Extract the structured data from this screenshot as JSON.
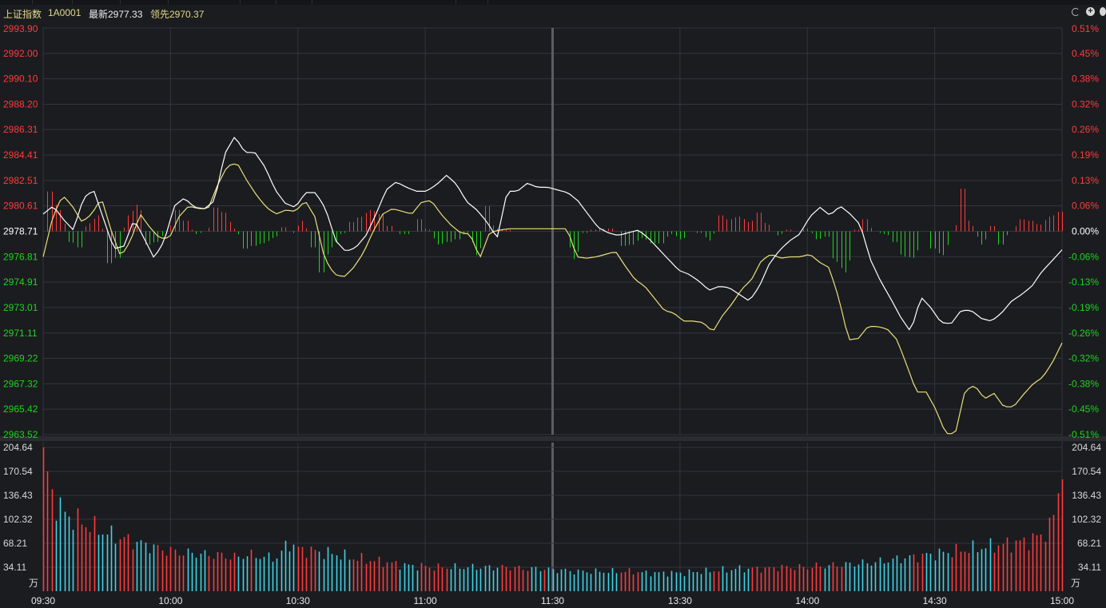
{
  "header": {
    "index_name": "上证指数",
    "code": "1A0001",
    "latest_label": "最新2977.33",
    "lead_label": "领先2970.37"
  },
  "colors": {
    "background": "#1b1c20",
    "grid": "#33353b",
    "up_red": "#ff3b3b",
    "down_green": "#1ed41e",
    "price_line": "#ffffff",
    "lead_line": "#e8e07a",
    "volume_cyan": "#3fd3e6",
    "header_yellow": "#e0d98a"
  },
  "chart_data": [
    {
      "type": "line",
      "name": "intraday price",
      "prev_close": 2978.71,
      "left_axis_ticks": [
        "2993.90",
        "2992.00",
        "2990.10",
        "2988.20",
        "2986.31",
        "2984.41",
        "2982.51",
        "2980.61",
        "2978.71",
        "2976.81",
        "2974.91",
        "2973.01",
        "2971.11",
        "2969.22",
        "2967.32",
        "2965.42",
        "2963.52"
      ],
      "right_axis_ticks": [
        "0.51%",
        "0.45%",
        "0.38%",
        "0.32%",
        "0.26%",
        "0.19%",
        "0.13%",
        "0.06%",
        "0.00%",
        "-0.06%",
        "-0.13%",
        "-0.19%",
        "-0.26%",
        "-0.32%",
        "-0.38%",
        "-0.45%",
        "-0.51%"
      ],
      "ylim": [
        2963.52,
        2993.9
      ],
      "x_ticks": [
        "09:30",
        "10:00",
        "10:30",
        "11:00",
        "11:30",
        "13:30",
        "14:00",
        "14:30",
        "15:00"
      ],
      "price_series": [
        2980.0,
        2980.6,
        2979.6,
        2978.8,
        2981.2,
        2981.8,
        2979.6,
        2977.4,
        2977.6,
        2979.6,
        2978.2,
        2976.7,
        2978.0,
        2980.6,
        2981.2,
        2980.5,
        2980.4,
        2981.0,
        2984.5,
        2985.8,
        2984.6,
        2984.6,
        2983.5,
        2981.8,
        2980.8,
        2980.5,
        2981.6,
        2981.6,
        2980.4,
        2978.0,
        2977.2,
        2977.5,
        2978.4,
        2980.0,
        2981.8,
        2982.4,
        2982.0,
        2981.7,
        2981.7,
        2982.2,
        2982.9,
        2982.2,
        2980.9,
        2980.3,
        2979.4,
        2978.2,
        2981.7,
        2981.7,
        2982.3,
        2982.0,
        2982.0,
        2981.8,
        2981.6,
        2981.0,
        2980.0,
        2979.0,
        2978.6,
        2978.4,
        2978.6,
        2978.8,
        2978.2,
        2977.4,
        2976.6,
        2975.8,
        2975.5,
        2975.0,
        2974.3,
        2974.6,
        2974.5,
        2974.0,
        2973.5,
        2974.6,
        2976.3,
        2977.3,
        2978.0,
        2978.5,
        2979.8,
        2980.5,
        2979.9,
        2980.6,
        2980.0,
        2979.2,
        2976.6,
        2975.0,
        2973.7,
        2972.3,
        2971.2,
        2973.8,
        2973.0,
        2971.9,
        2971.8,
        2972.8,
        2972.8,
        2972.2,
        2972.0,
        2972.6,
        2973.5,
        2974.0,
        2974.6,
        2975.7,
        2976.5,
        2977.33
      ],
      "lead_series": [
        2976.8,
        2979.8,
        2981.4,
        2980.6,
        2979.4,
        2980.0,
        2981.2,
        2978.8,
        2976.8,
        2978.0,
        2980.0,
        2979.0,
        2978.2,
        2978.2,
        2979.8,
        2980.6,
        2980.4,
        2980.4,
        2982.2,
        2983.6,
        2983.8,
        2982.5,
        2981.4,
        2980.5,
        2980.0,
        2980.3,
        2980.2,
        2981.0,
        2979.8,
        2976.7,
        2975.5,
        2975.3,
        2976.0,
        2977.1,
        2978.7,
        2980.0,
        2980.4,
        2980.2,
        2980.0,
        2980.9,
        2981.0,
        2980.0,
        2979.2,
        2978.6,
        2978.5,
        2976.7,
        2978.6,
        2978.8,
        2978.9,
        2978.9,
        2978.9,
        2978.9,
        2978.9,
        2978.9,
        2978.9,
        2976.8,
        2976.7,
        2976.8,
        2977.0,
        2977.2,
        2976.1,
        2975.1,
        2974.6,
        2973.7,
        2972.8,
        2972.6,
        2972.0,
        2972.0,
        2971.9,
        2971.2,
        2972.4,
        2973.3,
        2974.4,
        2975.1,
        2976.5,
        2977.0,
        2976.7,
        2976.8,
        2976.8,
        2977.0,
        2976.4,
        2976.0,
        2973.7,
        2970.6,
        2970.7,
        2971.6,
        2971.6,
        2971.4,
        2970.6,
        2968.7,
        2966.7,
        2966.7,
        2965.4,
        2963.6,
        2963.6,
        2966.8,
        2967.2,
        2966.2,
        2966.6,
        2965.6,
        2965.6,
        2966.5,
        2967.3,
        2967.8,
        2968.9,
        2970.37
      ]
    },
    {
      "type": "bar",
      "name": "volume",
      "unit": "万",
      "ylim": [
        0,
        204.64
      ],
      "axis_ticks": [
        "204.64",
        "170.54",
        "136.43",
        "102.32",
        "68.21",
        "34.11"
      ],
      "values": [
        190,
        128,
        112,
        102,
        96,
        90,
        84,
        78,
        74,
        70,
        66,
        62,
        58,
        56,
        54,
        54,
        52,
        52,
        50,
        48,
        52,
        50,
        48,
        48,
        70,
        60,
        58,
        56,
        54,
        52,
        48,
        46,
        44,
        42,
        40,
        38,
        36,
        36,
        34,
        34,
        34,
        34,
        34,
        34,
        34,
        34,
        34,
        32,
        32,
        32,
        30,
        30,
        28,
        28,
        28,
        28,
        28,
        28,
        28,
        26,
        26,
        26,
        26,
        26,
        28,
        28,
        30,
        30,
        32,
        32,
        32,
        32,
        34,
        34,
        34,
        34,
        36,
        36,
        38,
        38,
        40,
        40,
        42,
        44,
        46,
        48,
        50,
        52,
        54,
        56,
        58,
        60,
        62,
        64,
        66,
        68,
        70,
        74,
        80,
        94,
        180
      ]
    }
  ]
}
